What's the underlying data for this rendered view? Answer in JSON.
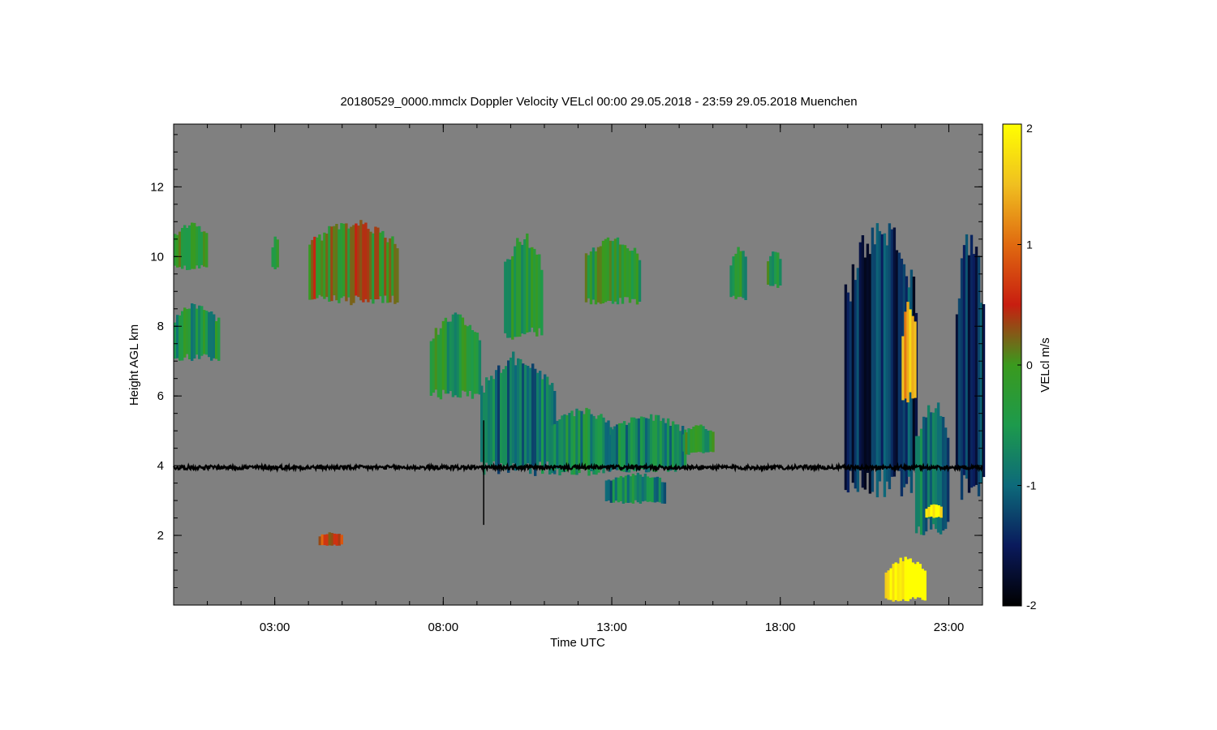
{
  "chart_data": {
    "type": "heatmap",
    "title": "20180529_0000.mmclx Doppler Velocity VELcl   00:00 29.05.2018 - 23:59 29.05.2018 Muenchen",
    "xlabel": "Time UTC",
    "ylabel": "Height AGL km",
    "x_range_hours": [
      0.0,
      24.0
    ],
    "y_range_km": [
      0.0,
      13.8
    ],
    "x_ticks": [
      {
        "hours": 3,
        "label": "03:00"
      },
      {
        "hours": 8,
        "label": "08:00"
      },
      {
        "hours": 13,
        "label": "13:00"
      },
      {
        "hours": 18,
        "label": "18:00"
      },
      {
        "hours": 23,
        "label": "23:00"
      }
    ],
    "y_ticks": [
      {
        "km": 2,
        "label": "2"
      },
      {
        "km": 4,
        "label": "4"
      },
      {
        "km": 6,
        "label": "6"
      },
      {
        "km": 8,
        "label": "8"
      },
      {
        "km": 10,
        "label": "10"
      },
      {
        "km": 12,
        "label": "12"
      }
    ],
    "background_color": "#808080",
    "colorbar": {
      "label": "VELcl m/s",
      "range": [
        -2,
        2
      ],
      "ticks": [
        {
          "value": 2,
          "label": "2"
        },
        {
          "value": 1,
          "label": "1"
        },
        {
          "value": 0,
          "label": "0"
        },
        {
          "value": -1,
          "label": "-1"
        },
        {
          "value": -2,
          "label": "-2"
        }
      ],
      "stops": [
        {
          "value": -2.0,
          "color": "#000000"
        },
        {
          "value": -1.5,
          "color": "#0a1a5c"
        },
        {
          "value": -1.0,
          "color": "#0d6a7a"
        },
        {
          "value": -0.5,
          "color": "#1d9a4c"
        },
        {
          "value": 0.0,
          "color": "#3a9a1e"
        },
        {
          "value": 0.5,
          "color": "#c81e10"
        },
        {
          "value": 1.0,
          "color": "#e06a10"
        },
        {
          "value": 1.5,
          "color": "#f0c020"
        },
        {
          "value": 2.0,
          "color": "#ffff00"
        }
      ]
    },
    "echo_regions": [
      {
        "t0": 0.0,
        "t1": 1.0,
        "h0": 9.6,
        "h1": 11.0,
        "v": -0.1
      },
      {
        "t0": 0.0,
        "t1": 1.3,
        "h0": 7.0,
        "h1": 8.7,
        "v": -0.5
      },
      {
        "t0": 2.9,
        "t1": 3.1,
        "h0": 9.6,
        "h1": 10.6,
        "v": -0.2
      },
      {
        "t0": 4.0,
        "t1": 6.6,
        "h0": 8.6,
        "h1": 11.1,
        "v": 0.1
      },
      {
        "t0": 7.6,
        "t1": 9.1,
        "h0": 5.9,
        "h1": 8.4,
        "v": -0.4
      },
      {
        "t0": 9.1,
        "t1": 11.3,
        "h0": 3.7,
        "h1": 7.3,
        "v": -0.9
      },
      {
        "t0": 9.8,
        "t1": 10.9,
        "h0": 7.6,
        "h1": 10.7,
        "v": -0.3
      },
      {
        "t0": 11.2,
        "t1": 13.0,
        "h0": 3.7,
        "h1": 5.7,
        "v": -0.6
      },
      {
        "t0": 12.9,
        "t1": 15.2,
        "h0": 3.8,
        "h1": 5.5,
        "v": -0.7
      },
      {
        "t0": 12.8,
        "t1": 14.6,
        "h0": 2.9,
        "h1": 3.8,
        "v": -0.8
      },
      {
        "t0": 15.1,
        "t1": 16.0,
        "h0": 4.3,
        "h1": 5.2,
        "v": -0.3
      },
      {
        "t0": 12.2,
        "t1": 13.8,
        "h0": 8.6,
        "h1": 10.6,
        "v": -0.3
      },
      {
        "t0": 16.5,
        "t1": 17.0,
        "h0": 8.7,
        "h1": 10.3,
        "v": -0.4
      },
      {
        "t0": 17.6,
        "t1": 18.0,
        "h0": 9.1,
        "h1": 10.2,
        "v": -0.3
      },
      {
        "t0": 19.9,
        "t1": 22.0,
        "h0": 3.0,
        "h1": 11.3,
        "v": -1.4
      },
      {
        "t0": 21.6,
        "t1": 22.0,
        "h0": 5.8,
        "h1": 8.8,
        "v": 1.5
      },
      {
        "t0": 22.0,
        "t1": 23.0,
        "h0": 2.0,
        "h1": 6.0,
        "v": -1.0
      },
      {
        "t0": 23.2,
        "t1": 24.0,
        "h0": 3.0,
        "h1": 11.0,
        "v": -1.3
      },
      {
        "t0": 21.1,
        "t1": 22.3,
        "h0": 0.1,
        "h1": 1.4,
        "v": 2.0
      },
      {
        "t0": 22.3,
        "t1": 22.8,
        "h0": 2.5,
        "h1": 2.9,
        "v": 1.8
      },
      {
        "t0": 4.3,
        "t1": 5.0,
        "h0": 1.7,
        "h1": 2.1,
        "v": 0.6
      }
    ],
    "line_features": [
      {
        "name": "",
        "t0": 0.0,
        "t1": 24.0,
        "h": 3.95
      },
      {
        "name": "",
        "t": 9.2,
        "h0": 2.3,
        "h1": 5.3
      }
    ]
  }
}
